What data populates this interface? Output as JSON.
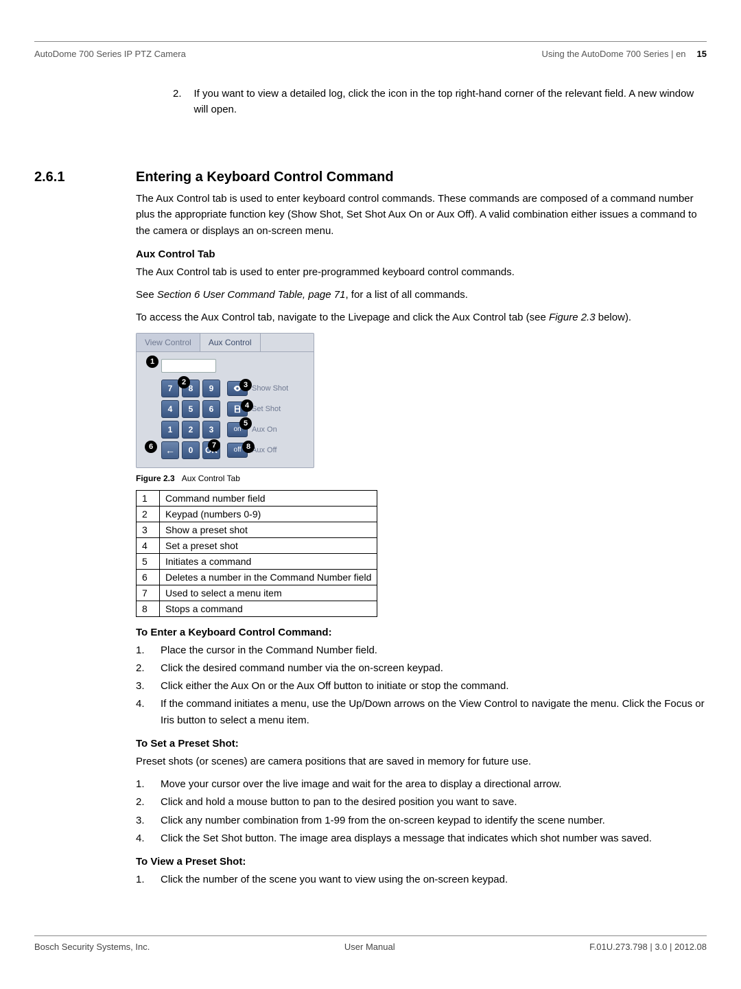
{
  "header": {
    "left": "AutoDome 700 Series IP PTZ Camera",
    "right_section": "Using the AutoDome 700 Series | en",
    "page_number": "15"
  },
  "intro": {
    "num": "2.",
    "text": "If you want to view a detailed log, click the icon in the top right-hand corner of the relevant field. A new window will open."
  },
  "section": {
    "number": "2.6.1",
    "title": "Entering a Keyboard Control Command",
    "para": "The Aux Control tab is used to enter keyboard control commands. These commands are composed of a command number plus the appropriate function key (Show Shot, Set Shot Aux On or Aux Off). A valid combination either issues a command to the camera or displays an on-screen menu."
  },
  "aux": {
    "heading": "Aux Control Tab",
    "p1": "The Aux Control tab is used to enter pre-programmed keyboard control commands.",
    "p2_pre": "See ",
    "p2_em": "Section 6 User Command Table, page 71",
    "p2_post": ", for a list of all commands.",
    "p3_pre": "To access the Aux Control tab, navigate to the Livepage and click the Aux Control tab (see ",
    "p3_em": "Figure 2.3",
    "p3_post": " below)."
  },
  "panel": {
    "tab_view": "View Control",
    "tab_aux": "Aux Control",
    "keys": {
      "k7": "7",
      "k8": "8",
      "k9": "9",
      "k4": "4",
      "k5": "5",
      "k6": "6",
      "k1": "1",
      "k2": "2",
      "k3": "3",
      "kback": "←",
      "k0": "0",
      "kok": "OK"
    },
    "side": {
      "show": "Show Shot",
      "set": "Set Shot",
      "on_btn": "on",
      "on": "Aux On",
      "off_btn": "off",
      "off": "Aux Off"
    }
  },
  "figure": {
    "label": "Figure 2.3",
    "caption": "Aux Control Tab"
  },
  "table": {
    "rows": [
      {
        "n": "1",
        "d": "Command number field"
      },
      {
        "n": "2",
        "d": "Keypad (numbers 0-9)"
      },
      {
        "n": "3",
        "d": "Show a preset shot"
      },
      {
        "n": "4",
        "d": "Set a preset shot"
      },
      {
        "n": "5",
        "d": "Initiates a command"
      },
      {
        "n": "6",
        "d": "Deletes a number in the Command Number field"
      },
      {
        "n": "7",
        "d": "Used to select a menu item"
      },
      {
        "n": "8",
        "d": "Stops a command"
      }
    ]
  },
  "enter_cmd": {
    "heading": "To Enter a Keyboard Control Command:",
    "steps": [
      {
        "n": "1.",
        "t": "Place the cursor in the Command Number field."
      },
      {
        "n": "2.",
        "t": "Click the desired command number via the on-screen keypad."
      },
      {
        "n": "3.",
        "t": "Click either the Aux On or the Aux Off button to initiate or stop the command."
      },
      {
        "n": "4.",
        "t": "If the command initiates a menu, use the Up/Down arrows on the View Control to navigate the menu. Click the Focus or Iris button to select a menu item."
      }
    ]
  },
  "set_shot": {
    "heading": "To Set a Preset Shot:",
    "intro": "Preset shots (or scenes) are camera positions that are saved in memory for future use.",
    "steps": [
      {
        "n": "1.",
        "t": "Move your cursor over the live image and wait for the area to display a directional arrow."
      },
      {
        "n": "2.",
        "t": "Click and hold a mouse button to pan to the desired position you want to save."
      },
      {
        "n": "3.",
        "t": "Click any number combination from 1-99 from the on-screen keypad to identify the scene number."
      },
      {
        "n": "4.",
        "t": "Click the Set Shot button. The image area displays a message that indicates which shot number was saved."
      }
    ]
  },
  "view_shot": {
    "heading": "To View a Preset Shot:",
    "steps": [
      {
        "n": "1.",
        "t": "Click the number of the scene you want to view using the on-screen keypad."
      }
    ]
  },
  "footer": {
    "left": "Bosch Security Systems, Inc.",
    "center": "User Manual",
    "right": "F.01U.273.798  | 3.0 | 2012.08"
  }
}
